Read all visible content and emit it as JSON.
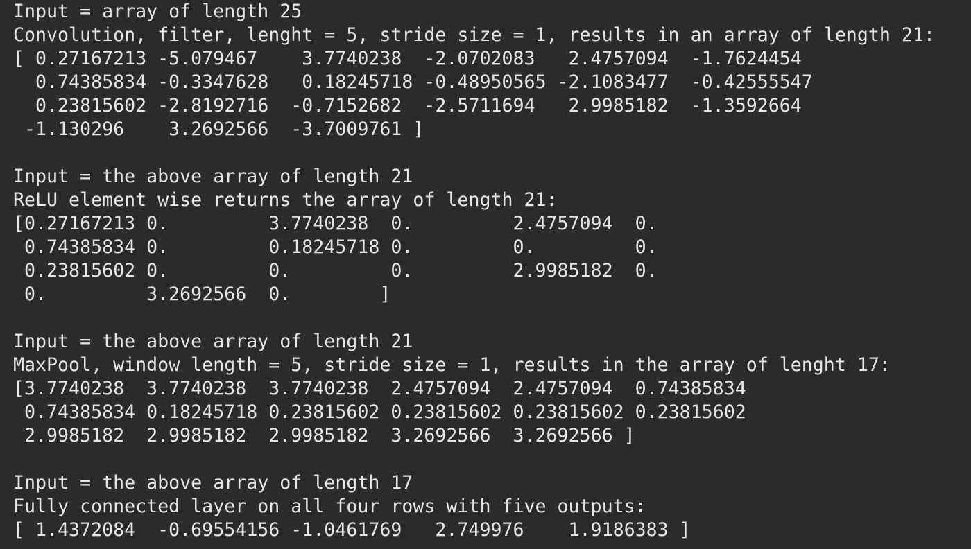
{
  "terminal": {
    "blocks": [
      {
        "lines": [
          "Input = array of length 25",
          "Convolution, filter, lenght = 5, stride size = 1, results in an array of length 21:",
          "[ 0.27167213 -5.079467    3.7740238  -2.0702083   2.4757094  -1.7624454",
          "  0.74385834 -0.3347628   0.18245718 -0.48950565 -2.1083477  -0.42555547",
          "  0.23815602 -2.8192716  -0.7152682  -2.5711694   2.9985182  -1.3592664",
          " -1.130296    3.2692566  -3.7009761 ]"
        ]
      },
      {
        "lines": [
          "Input = the above array of length 21",
          "ReLU element wise returns the array of length 21:",
          "[0.27167213 0.         3.7740238  0.         2.4757094  0.",
          " 0.74385834 0.         0.18245718 0.         0.         0.",
          " 0.23815602 0.         0.         0.         2.9985182  0.",
          " 0.         3.2692566  0.        ]"
        ]
      },
      {
        "lines": [
          "Input = the above array of length 21",
          "MaxPool, window length = 5, stride size = 1, results in the array of lenght 17:",
          "[3.7740238  3.7740238  3.7740238  2.4757094  2.4757094  0.74385834",
          " 0.74385834 0.18245718 0.23815602 0.23815602 0.23815602 0.23815602",
          " 2.9985182  2.9985182  2.9985182  3.2692566  3.2692566 ]"
        ]
      },
      {
        "lines": [
          "Input = the above array of length 17",
          "Fully connected layer on all four rows with five outputs:",
          "[ 1.4372084  -0.69554156 -1.0461769   2.749976    1.9186383 ]"
        ]
      }
    ]
  }
}
